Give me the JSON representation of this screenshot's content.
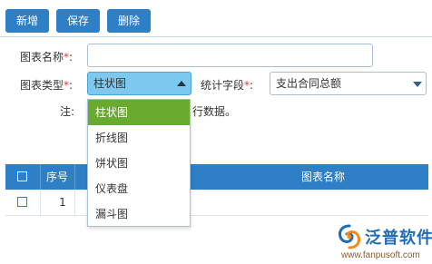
{
  "toolbar": {
    "add_label": "新增",
    "save_label": "保存",
    "delete_label": "删除"
  },
  "form": {
    "chart_name_label": "图表名称",
    "chart_type_label": "图表类型",
    "stat_field_label": "统计字段",
    "required_mark": "*",
    "colon": ":",
    "chart_name_value": "",
    "chart_type_selected": "柱状图",
    "stat_field_selected": "支出合同总额",
    "note_label": "注:",
    "note_text": "行数据。"
  },
  "dropdown": {
    "options": [
      "柱状图",
      "折线图",
      "饼状图",
      "仪表盘",
      "漏斗图"
    ],
    "selected_index": 0
  },
  "grid": {
    "columns": {
      "index": "序号",
      "name": "图表名称"
    },
    "rows": [
      {
        "index": "1",
        "name": ""
      }
    ]
  },
  "logo": {
    "brand_text": "泛普软件",
    "url_text": "www.fanpusoft.com"
  },
  "colors": {
    "primary": "#2f7fc6",
    "selected_option": "#6aaa2e",
    "required": "#e33333",
    "select_bg": "#7cc8ee",
    "logo_blue": "#1e6bb8",
    "logo_orange": "#f08a1c"
  },
  "icons": {
    "dropdown_arrow_up": "triangle-up",
    "dropdown_arrow_down": "triangle-down",
    "checkbox": "square-outline",
    "logo_mark": "swirl"
  }
}
